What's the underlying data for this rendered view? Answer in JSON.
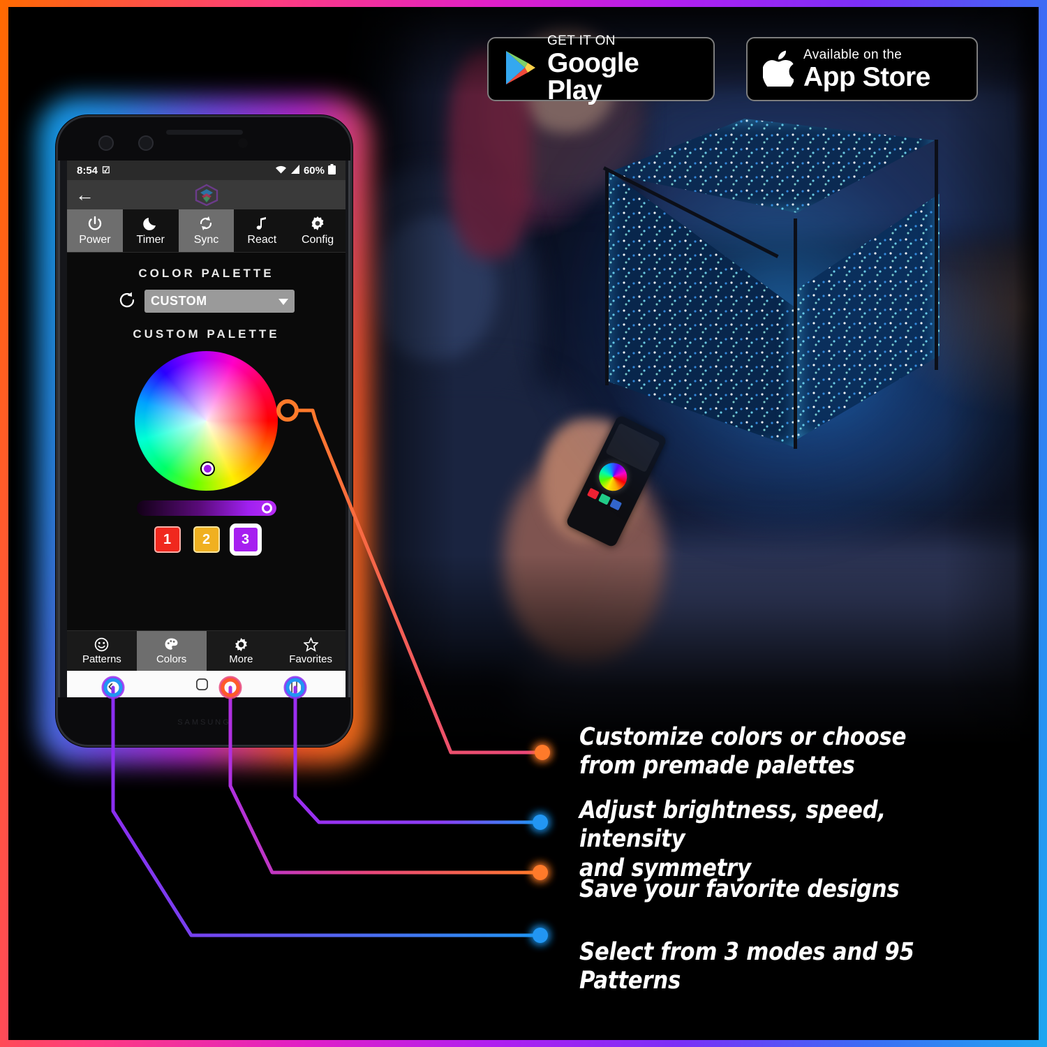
{
  "store_badges": [
    {
      "name": "google-play",
      "small": "GET IT ON",
      "big": "Google Play",
      "icon": "google-play-icon"
    },
    {
      "name": "app-store",
      "small": "Available on the",
      "big": "App Store",
      "icon": "apple-icon"
    }
  ],
  "phone": {
    "status_bar": {
      "time": "8:54",
      "battery": "60%",
      "wifi_icon": "wifi-icon",
      "signal_icon": "signal-icon",
      "battery_icon": "battery-icon",
      "notification_icon": "calendar-check-icon"
    },
    "app_bar": {
      "back_icon": "back-arrow-icon",
      "logo_icon": "app-logo-icon"
    },
    "modes": [
      {
        "label": "Power",
        "icon": "power-icon",
        "active": true
      },
      {
        "label": "Timer",
        "icon": "moon-icon",
        "active": false
      },
      {
        "label": "Sync",
        "icon": "sync-icon",
        "active": true
      },
      {
        "label": "React",
        "icon": "music-note-icon",
        "active": false
      },
      {
        "label": "Config",
        "icon": "gear-icon",
        "active": false
      }
    ],
    "color_palette": {
      "heading": "COLOR  PALETTE",
      "reset_icon": "reset-icon",
      "selected": "CUSTOM",
      "dropdown_icon": "chevron-down-icon"
    },
    "custom_palette": {
      "heading": "CUSTOM  PALETTE",
      "wheel_icon": "color-wheel",
      "brightness_label": "brightness-slider",
      "swatches": [
        {
          "label": "1",
          "color": "#f0281e",
          "selected": false
        },
        {
          "label": "2",
          "color": "#f0b020",
          "selected": false
        },
        {
          "label": "3",
          "color": "#a61ef0",
          "selected": true
        }
      ]
    },
    "bottom_nav": [
      {
        "label": "Patterns",
        "icon": "smiley-icon",
        "active": false
      },
      {
        "label": "Colors",
        "icon": "palette-icon",
        "active": true
      },
      {
        "label": "More",
        "icon": "sun-gear-icon",
        "active": false
      },
      {
        "label": "Favorites",
        "icon": "star-icon",
        "active": false
      }
    ],
    "android_nav": [
      {
        "icon": "back-chevron-icon"
      },
      {
        "icon": "home-square-icon"
      },
      {
        "icon": "recents-icon"
      }
    ],
    "brand": "SAMSUNG"
  },
  "features": [
    {
      "text_lines": [
        "Customize colors or choose",
        "from premade palettes"
      ],
      "dot_color": "#ff7a2a"
    },
    {
      "text_lines": [
        "Adjust brightness, speed, intensity",
        "and symmetry"
      ],
      "dot_color": "#2196f3"
    },
    {
      "text_lines": [
        "Save your favorite designs"
      ],
      "dot_color": "#ff7a2a"
    },
    {
      "text_lines": [
        "Select from 3 modes and 95 Patterns"
      ],
      "dot_color": "#2196f3"
    }
  ],
  "colors": {
    "frame_gradient_start": "#ff6a00",
    "frame_gradient_end": "#1ea7f0",
    "orange": "#ff7a2a",
    "blue": "#2196f3",
    "purple": "#a020f0",
    "pink": "#e8467c"
  }
}
